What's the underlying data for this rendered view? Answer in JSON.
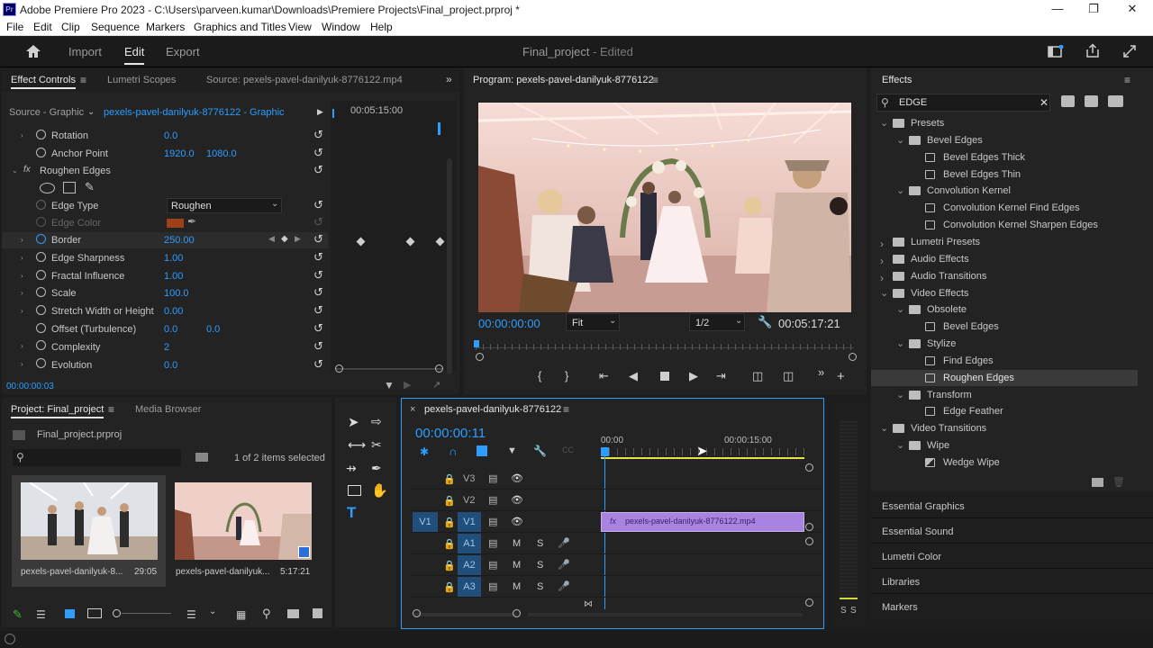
{
  "window": {
    "title": "Adobe Premiere Pro 2023 - C:\\Users\\parveen.kumar\\Downloads\\Premiere Projects\\Final_project.prproj *",
    "logo": "Pr"
  },
  "menu": [
    "File",
    "Edit",
    "Clip",
    "Sequence",
    "Markers",
    "Graphics and Titles",
    "View",
    "Window",
    "Help"
  ],
  "workspace": {
    "tabs": [
      "Import",
      "Edit",
      "Export"
    ],
    "active": "Edit",
    "project_title": "Final_project",
    "status": "- Edited"
  },
  "effect_controls": {
    "tabs": [
      "Effect Controls",
      "Lumetri Scopes",
      "Source: pexels-pavel-danilyuk-8776122.mp4"
    ],
    "source_label": "Source - Graphic",
    "clip_label": "pexels-pavel-danilyuk-8776122 - Graphic",
    "timecode_ruler": "00:05:15:00",
    "current_time": "00:00:00:03",
    "rows": [
      {
        "name": "Rotation",
        "v1": "0.0",
        "v2": ""
      },
      {
        "name": "Anchor Point",
        "v1": "1920.0",
        "v2": "1080.0"
      },
      {
        "name": "Roughen Edges",
        "v1": "",
        "v2": ""
      },
      {
        "name": "Edge Type",
        "v1": "Roughen",
        "v2": ""
      },
      {
        "name": "Edge Color",
        "v1": "",
        "v2": ""
      },
      {
        "name": "Border",
        "v1": "250.00",
        "v2": ""
      },
      {
        "name": "Edge Sharpness",
        "v1": "1.00",
        "v2": ""
      },
      {
        "name": "Fractal Influence",
        "v1": "1.00",
        "v2": ""
      },
      {
        "name": "Scale",
        "v1": "100.0",
        "v2": ""
      },
      {
        "name": "Stretch Width or Height",
        "v1": "0.00",
        "v2": ""
      },
      {
        "name": "Offset (Turbulence)",
        "v1": "0.0",
        "v2": "0.0"
      },
      {
        "name": "Complexity",
        "v1": "2",
        "v2": ""
      },
      {
        "name": "Evolution",
        "v1": "0.0",
        "v2": ""
      }
    ],
    "edge_color": "#a0401a"
  },
  "program": {
    "title": "Program: pexels-pavel-danilyuk-8776122",
    "timecode": "00:00:00:00",
    "fit": "Fit",
    "resolution": "1/2",
    "duration": "00:05:17:21"
  },
  "project": {
    "tabs": [
      "Project: Final_project",
      "Media Browser"
    ],
    "file": "Final_project.prproj",
    "selected_count": "1 of 2 items selected",
    "items": [
      {
        "name": "pexels-pavel-danilyuk-8...",
        "duration": "29:05"
      },
      {
        "name": "pexels-pavel-danilyuk...",
        "duration": "5:17:21"
      }
    ]
  },
  "timeline": {
    "title": "pexels-pavel-danilyuk-8776122",
    "timecode": "00:00:00:11",
    "ruler": [
      "00:00",
      "00:00:15:00"
    ],
    "tracks": [
      {
        "name": "V3",
        "src": ""
      },
      {
        "name": "V2",
        "src": ""
      },
      {
        "name": "V1",
        "src": "V1"
      },
      {
        "name": "A1",
        "src": ""
      },
      {
        "name": "A2",
        "src": ""
      },
      {
        "name": "A3",
        "src": ""
      }
    ],
    "clip": "pexels-pavel-danilyuk-8776122.mp4",
    "clip_fx": "fx",
    "track_letters": {
      "mute": "M",
      "solo": "S"
    },
    "meter": [
      "S",
      "S"
    ]
  },
  "effects": {
    "title": "Effects",
    "search": "EDGE",
    "tree": [
      {
        "label": "Presets",
        "depth": 0,
        "type": "folder",
        "open": true
      },
      {
        "label": "Bevel Edges",
        "depth": 1,
        "type": "folder",
        "open": true
      },
      {
        "label": "Bevel Edges Thick",
        "depth": 2,
        "type": "preset"
      },
      {
        "label": "Bevel Edges Thin",
        "depth": 2,
        "type": "preset"
      },
      {
        "label": "Convolution Kernel",
        "depth": 1,
        "type": "folder",
        "open": true
      },
      {
        "label": "Convolution Kernel Find Edges",
        "depth": 2,
        "type": "preset"
      },
      {
        "label": "Convolution Kernel Sharpen Edges",
        "depth": 2,
        "type": "preset"
      },
      {
        "label": "Lumetri Presets",
        "depth": 0,
        "type": "folder",
        "open": false
      },
      {
        "label": "Audio Effects",
        "depth": 0,
        "type": "folder",
        "open": false
      },
      {
        "label": "Audio Transitions",
        "depth": 0,
        "type": "folder",
        "open": false
      },
      {
        "label": "Video Effects",
        "depth": 0,
        "type": "folder",
        "open": true
      },
      {
        "label": "Obsolete",
        "depth": 1,
        "type": "folder",
        "open": true
      },
      {
        "label": "Bevel Edges",
        "depth": 2,
        "type": "preset"
      },
      {
        "label": "Stylize",
        "depth": 1,
        "type": "folder",
        "open": true
      },
      {
        "label": "Find Edges",
        "depth": 2,
        "type": "preset"
      },
      {
        "label": "Roughen Edges",
        "depth": 2,
        "type": "preset",
        "selected": true
      },
      {
        "label": "Transform",
        "depth": 1,
        "type": "folder",
        "open": true
      },
      {
        "label": "Edge Feather",
        "depth": 2,
        "type": "preset"
      },
      {
        "label": "Video Transitions",
        "depth": 0,
        "type": "folder",
        "open": true
      },
      {
        "label": "Wipe",
        "depth": 1,
        "type": "folder",
        "open": true
      },
      {
        "label": "Wedge Wipe",
        "depth": 2,
        "type": "transition"
      }
    ],
    "collapsed_panels": [
      "Essential Graphics",
      "Essential Sound",
      "Lumetri Color",
      "Libraries",
      "Markers"
    ]
  },
  "colors": {
    "accent_blue": "#2d9dff",
    "clip_purple": "#a883e0",
    "panel_bg": "#232323",
    "playhead": "#2d9dff"
  }
}
